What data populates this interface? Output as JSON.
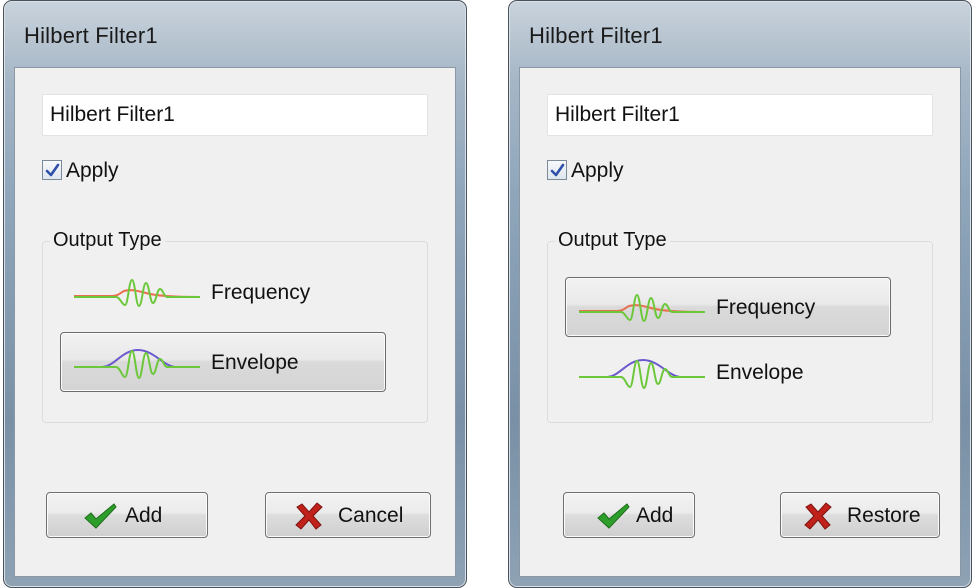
{
  "dialogs": [
    {
      "title": "Hilbert Filter1",
      "name_value": "Hilbert Filter1",
      "apply_label": "Apply",
      "apply_checked": true,
      "group_label": "Output Type",
      "options": [
        {
          "label": "Frequency",
          "icon": "frequency-waveform-icon",
          "selected": false
        },
        {
          "label": "Envelope",
          "icon": "envelope-waveform-icon",
          "selected": true
        }
      ],
      "buttons": [
        {
          "label": "Add",
          "icon": "check-icon"
        },
        {
          "label": "Cancel",
          "icon": "x-icon"
        }
      ]
    },
    {
      "title": "Hilbert Filter1",
      "name_value": "Hilbert Filter1",
      "apply_label": "Apply",
      "apply_checked": true,
      "group_label": "Output Type",
      "options": [
        {
          "label": "Frequency",
          "icon": "frequency-waveform-icon",
          "selected": true
        },
        {
          "label": "Envelope",
          "icon": "envelope-waveform-icon",
          "selected": false
        }
      ],
      "buttons": [
        {
          "label": "Add",
          "icon": "check-icon"
        },
        {
          "label": "Restore",
          "icon": "x-icon"
        }
      ]
    }
  ],
  "colors": {
    "check_green": "#2e9e2a",
    "x_red": "#c0211b",
    "wave_green": "#6cc83a",
    "freq_red": "#e8704f",
    "env_purple": "#6a5acd"
  }
}
